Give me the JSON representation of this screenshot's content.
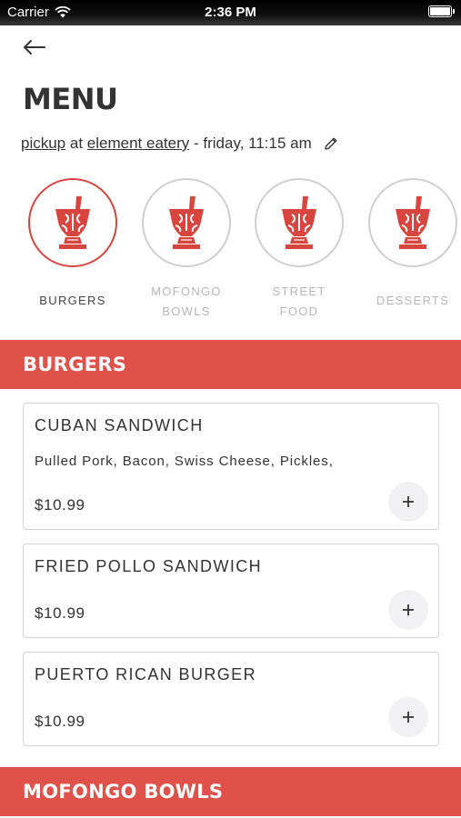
{
  "status_bar": {
    "carrier": "Carrier",
    "time": "2:36 PM"
  },
  "header": {
    "title": "MENU"
  },
  "order": {
    "mode": "pickup",
    "at_word": "at",
    "location": "element eatery",
    "time": "- friday, 11:15 am"
  },
  "categories": [
    {
      "label": "BURGERS",
      "active": true
    },
    {
      "label": "MOFONGO BOWLS",
      "line1": "MOFONGO",
      "line2": "BOWLS",
      "active": false
    },
    {
      "label": "STREET FOOD",
      "line1": "STREET",
      "line2": "FOOD",
      "active": false
    },
    {
      "label": "DESSERTS",
      "active": false
    }
  ],
  "sections": [
    {
      "title": "BURGERS",
      "items": [
        {
          "name": "CUBAN SANDWICH",
          "description": "Pulled Pork, Bacon, Swiss Cheese, Pickles,",
          "price": "$10.99",
          "add_label": "+"
        },
        {
          "name": "FRIED POLLO SANDWICH",
          "price": "$10.99",
          "add_label": "+"
        },
        {
          "name": "PUERTO RICAN BURGER",
          "price": "$10.99",
          "add_label": "+"
        }
      ]
    },
    {
      "title": "MOFONGO BOWLS"
    }
  ],
  "colors": {
    "accent": "#e0514a",
    "active_ring": "#d8453e",
    "inactive_ring": "#cfcfcf"
  },
  "icons": {
    "back": "arrow-left-icon",
    "edit": "pencil-icon",
    "category": "mortar-pestle-logo-icon",
    "add": "plus-icon"
  }
}
